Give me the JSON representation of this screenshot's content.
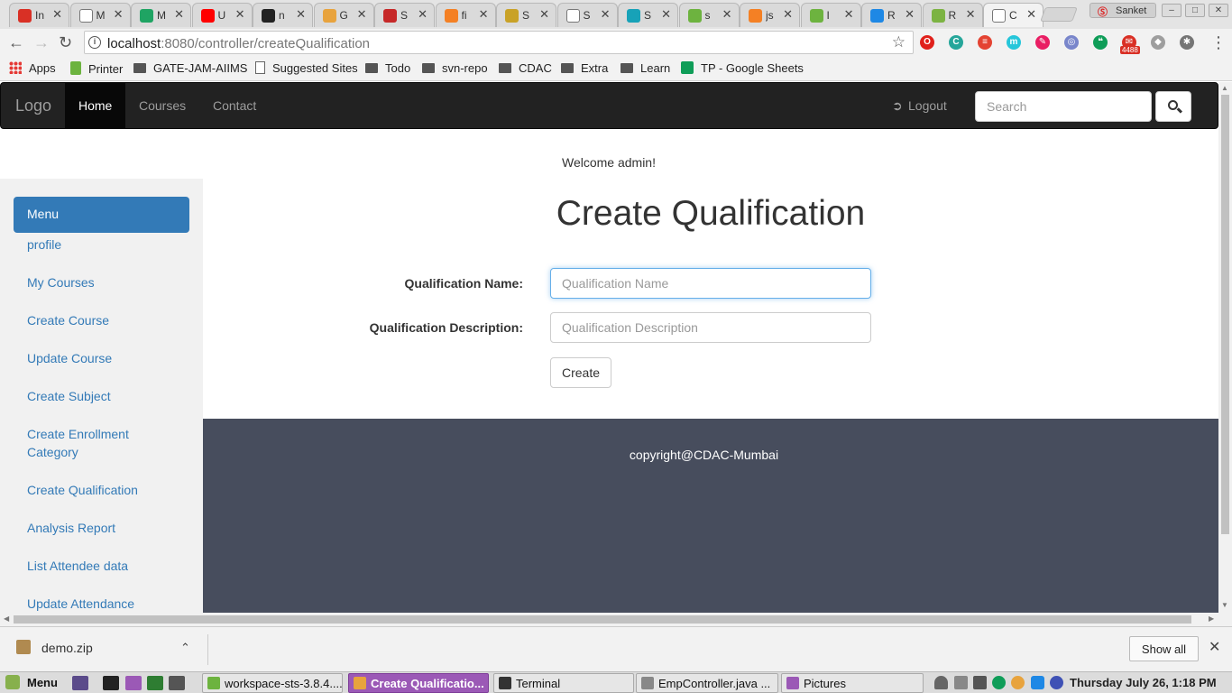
{
  "browser": {
    "tabs": [
      {
        "label": "In",
        "icon": "gmail-icon",
        "color": "#d93025"
      },
      {
        "label": "M",
        "icon": "page-icon",
        "color": "#ffffff"
      },
      {
        "label": "M",
        "icon": "drive-icon",
        "color": "#1fa463"
      },
      {
        "label": "U",
        "icon": "youtube-icon",
        "color": "#ff0000"
      },
      {
        "label": "n",
        "icon": "github-icon",
        "color": "#222222"
      },
      {
        "label": "G",
        "icon": "chrome-web-icon",
        "color": "#e8a33d"
      },
      {
        "label": "S",
        "icon": "javatpoint-icon",
        "color": "#c62828"
      },
      {
        "label": "fi",
        "icon": "stackoverflow-icon",
        "color": "#f48024"
      },
      {
        "label": "S",
        "icon": "udemy-icon",
        "color": "#c9a227"
      },
      {
        "label": "S",
        "icon": "page-icon",
        "color": "#ffffff"
      },
      {
        "label": "S",
        "icon": "bootstrap-icon",
        "color": "#17a2b8"
      },
      {
        "label": "s",
        "icon": "spring-icon",
        "color": "#6db33f"
      },
      {
        "label": "js",
        "icon": "stackoverflow-icon",
        "color": "#f48024"
      },
      {
        "label": "I",
        "icon": "spring-icon",
        "color": "#6db33f"
      },
      {
        "label": "R",
        "icon": "asp-icon",
        "color": "#1e88e5"
      },
      {
        "label": "R",
        "icon": "cube-icon",
        "color": "#7cb342"
      },
      {
        "label": "C",
        "icon": "page-icon",
        "color": "#ffffff",
        "active": true
      }
    ],
    "profile_name": "Sanket",
    "url_host": "localhost",
    "url_rest": ":8080/controller/createQualification",
    "extensions": [
      {
        "name": "opera-icon",
        "color": "#e0201b",
        "glyph": "O"
      },
      {
        "name": "c-extension-icon",
        "color": "#26a69a",
        "glyph": "C"
      },
      {
        "name": "todoist-icon",
        "color": "#e44332",
        "glyph": "≡"
      },
      {
        "name": "m-extension-icon",
        "color": "#26c6da",
        "glyph": "m"
      },
      {
        "name": "feather-icon",
        "color": "#e91e63",
        "glyph": "✎"
      },
      {
        "name": "compass-icon",
        "color": "#7986cb",
        "glyph": "◎"
      },
      {
        "name": "hangouts-icon",
        "color": "#0f9d58",
        "glyph": "❝"
      },
      {
        "name": "gmail-checker-icon",
        "color": "#d93025",
        "glyph": "✉"
      },
      {
        "name": "extension-grey-icon",
        "color": "#9e9e9e",
        "glyph": "◆"
      },
      {
        "name": "settings-extension-icon",
        "color": "#757575",
        "glyph": "✱"
      }
    ],
    "mail_badge": "4488",
    "bookmarks": [
      {
        "label": "Apps",
        "kind": "apps"
      },
      {
        "label": "Printer",
        "kind": "pr"
      },
      {
        "label": "GATE-JAM-AIIMS",
        "kind": "fold"
      },
      {
        "label": "Suggested Sites",
        "kind": "page"
      },
      {
        "label": "Todo",
        "kind": "fold"
      },
      {
        "label": "svn-repo",
        "kind": "fold"
      },
      {
        "label": "CDAC",
        "kind": "fold"
      },
      {
        "label": "Extra",
        "kind": "fold"
      },
      {
        "label": "Learn",
        "kind": "fold"
      },
      {
        "label": "TP - Google Sheets",
        "kind": "sheet"
      }
    ]
  },
  "navbar": {
    "brand": "Logo",
    "links": [
      "Home",
      "Courses",
      "Contact"
    ],
    "active": "Home",
    "logout": "Logout",
    "search_placeholder": "Search"
  },
  "welcome": "Welcome admin!",
  "sidebar": {
    "heading": "Menu",
    "items": [
      "profile",
      "My Courses",
      "Create Course",
      "Update Course",
      "Create Subject",
      "Create Enrollment Category",
      "Create Qualification",
      "Analysis Report",
      "List Attendee data",
      "Update Attendance"
    ]
  },
  "form": {
    "title": "Create Qualification",
    "name_label": "Qualification Name:",
    "name_placeholder": "Qualification Name",
    "desc_label": "Qualification Description:",
    "desc_placeholder": "Qualification Description",
    "submit": "Create"
  },
  "footer": {
    "copyright": "copyright@CDAC-Mumbai"
  },
  "downloads": {
    "file": "demo.zip",
    "show_all": "Show all"
  },
  "taskbar": {
    "menu": "Menu",
    "tasks": [
      {
        "label": "workspace-sts-3.8.4....",
        "icon": "sts-icon",
        "color": "#6db33f"
      },
      {
        "label": "Create Qualificatio...",
        "icon": "chrome-icon",
        "color": "#e8a33d",
        "active": true
      },
      {
        "label": "Terminal",
        "icon": "terminal-icon",
        "color": "#333333"
      },
      {
        "label": "EmpController.java ...",
        "icon": "editor-icon",
        "color": "#888888"
      },
      {
        "label": "Pictures",
        "icon": "folder-icon",
        "color": "#9b59b6"
      }
    ],
    "clock": "Thursday July 26,  1:18 PM"
  }
}
